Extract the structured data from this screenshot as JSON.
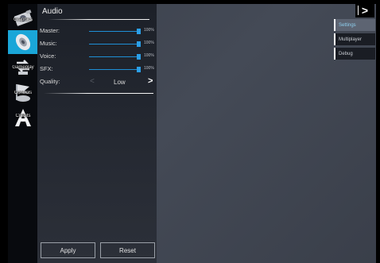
{
  "categories": [
    {
      "id": "graphics",
      "label": "Graphics",
      "icon": "camera-icon",
      "active": false
    },
    {
      "id": "audio",
      "label": "",
      "icon": "speaker-icon",
      "active": true
    },
    {
      "id": "gameplay",
      "label": "Gameplay",
      "icon": "move-arrows-icon",
      "active": false
    },
    {
      "id": "controls",
      "label": "Controls",
      "icon": "flag-icon",
      "active": false
    },
    {
      "id": "credits",
      "label": "Credits",
      "icon": "letter-a-icon",
      "active": false
    }
  ],
  "panel": {
    "title": "Audio",
    "sliders": [
      {
        "id": "master",
        "label": "Master:",
        "value": 100,
        "display": "100%"
      },
      {
        "id": "music",
        "label": "Music:",
        "value": 100,
        "display": "100%"
      },
      {
        "id": "voice",
        "label": "Voice:",
        "value": 100,
        "display": "100%"
      },
      {
        "id": "sfx",
        "label": "SFX:",
        "value": 100,
        "display": "100%"
      }
    ],
    "quality": {
      "label": "Quality:",
      "value": "Low",
      "prev": "<",
      "next": ">"
    },
    "apply_label": "Apply",
    "reset_label": "Reset"
  },
  "right_tabs": {
    "collapse_glyph": ">",
    "items": [
      {
        "label": "Settings",
        "active": true
      },
      {
        "label": "Multiplayer",
        "active": false
      },
      {
        "label": "Debug",
        "active": false
      }
    ]
  },
  "colors": {
    "accent": "#1aa6d8",
    "slider": "#2b9fe8"
  }
}
